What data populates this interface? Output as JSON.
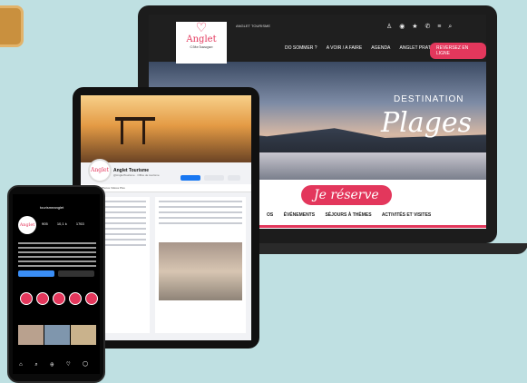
{
  "laptop": {
    "logo": {
      "heart": "♡",
      "name": "Anglet",
      "sub": "Côte basque"
    },
    "header_meta": "ANGLET TOURISME",
    "header_icons": "♙ ◉ ★ ✆ ≡ ⌕",
    "nav": [
      "DO SOMMER ?",
      "A VOIR / A FAIRE",
      "AGENDA",
      "ANGLET PRATIQUE"
    ],
    "nav_cta": "REVERSEZ EN LIGNE",
    "hero_kicker": "DESTINATION",
    "hero_title": "Plages",
    "reserve_label": "Je réserve",
    "categories": [
      "OS",
      "ÉVÉNEMENTS",
      "SÉJOURS À THÈMES",
      "ACTIVITÉS ET VISITES"
    ]
  },
  "tablet": {
    "page_name": "Anglet Tourisme",
    "page_sub": "@AngletTourisme · Office de tourisme",
    "avatar_text": "Anglet",
    "tabs": "Accueil   Avis   Photos   Vidéos   Plus"
  },
  "phone": {
    "handle": "tourismeanglet",
    "avatar_text": "Anglet",
    "stats": [
      "905",
      "10,1 k",
      "1763"
    ],
    "nav_icons": "⌂ ⌕ ⊕ ♡ ◯"
  },
  "colors": {
    "accent": "#e3375c",
    "background": "#bfe0e2"
  }
}
